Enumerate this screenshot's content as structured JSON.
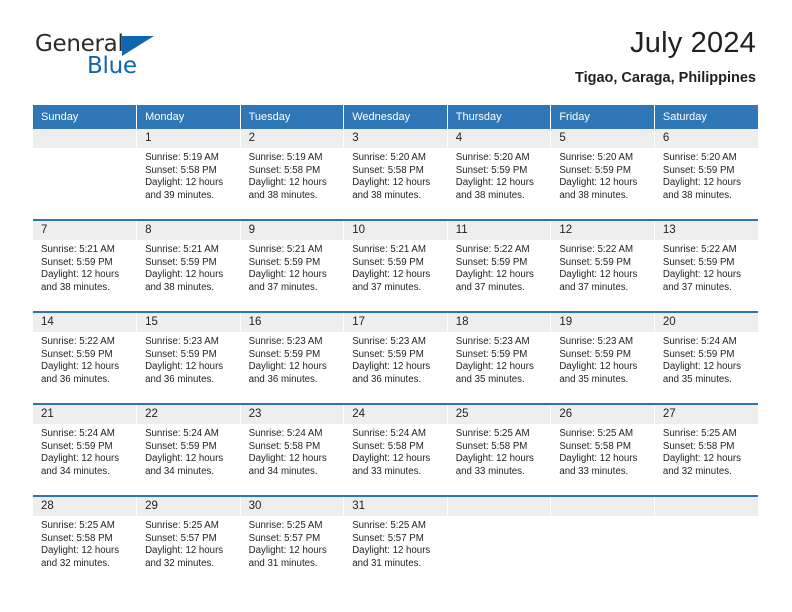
{
  "brand": {
    "name_part1": "General",
    "name_part2": "Blue",
    "logo_icon": "triangle-icon"
  },
  "header": {
    "title": "July 2024",
    "subtitle": "Tigao, Caraga, Philippines"
  },
  "colors": {
    "header_blue": "#3077b8",
    "row_border_blue": "#2e74b5",
    "daynum_bg": "#eeeeee",
    "brand_blue": "#1166b0",
    "text": "#231f20"
  },
  "weekday_headers": [
    "Sunday",
    "Monday",
    "Tuesday",
    "Wednesday",
    "Thursday",
    "Friday",
    "Saturday"
  ],
  "weeks": [
    [
      {
        "day": "",
        "sunrise": "",
        "sunset": "",
        "daylight_1": "",
        "daylight_2": ""
      },
      {
        "day": "1",
        "sunrise": "Sunrise: 5:19 AM",
        "sunset": "Sunset: 5:58 PM",
        "daylight_1": "Daylight: 12 hours",
        "daylight_2": "and 39 minutes."
      },
      {
        "day": "2",
        "sunrise": "Sunrise: 5:19 AM",
        "sunset": "Sunset: 5:58 PM",
        "daylight_1": "Daylight: 12 hours",
        "daylight_2": "and 38 minutes."
      },
      {
        "day": "3",
        "sunrise": "Sunrise: 5:20 AM",
        "sunset": "Sunset: 5:58 PM",
        "daylight_1": "Daylight: 12 hours",
        "daylight_2": "and 38 minutes."
      },
      {
        "day": "4",
        "sunrise": "Sunrise: 5:20 AM",
        "sunset": "Sunset: 5:59 PM",
        "daylight_1": "Daylight: 12 hours",
        "daylight_2": "and 38 minutes."
      },
      {
        "day": "5",
        "sunrise": "Sunrise: 5:20 AM",
        "sunset": "Sunset: 5:59 PM",
        "daylight_1": "Daylight: 12 hours",
        "daylight_2": "and 38 minutes."
      },
      {
        "day": "6",
        "sunrise": "Sunrise: 5:20 AM",
        "sunset": "Sunset: 5:59 PM",
        "daylight_1": "Daylight: 12 hours",
        "daylight_2": "and 38 minutes."
      }
    ],
    [
      {
        "day": "7",
        "sunrise": "Sunrise: 5:21 AM",
        "sunset": "Sunset: 5:59 PM",
        "daylight_1": "Daylight: 12 hours",
        "daylight_2": "and 38 minutes."
      },
      {
        "day": "8",
        "sunrise": "Sunrise: 5:21 AM",
        "sunset": "Sunset: 5:59 PM",
        "daylight_1": "Daylight: 12 hours",
        "daylight_2": "and 38 minutes."
      },
      {
        "day": "9",
        "sunrise": "Sunrise: 5:21 AM",
        "sunset": "Sunset: 5:59 PM",
        "daylight_1": "Daylight: 12 hours",
        "daylight_2": "and 37 minutes."
      },
      {
        "day": "10",
        "sunrise": "Sunrise: 5:21 AM",
        "sunset": "Sunset: 5:59 PM",
        "daylight_1": "Daylight: 12 hours",
        "daylight_2": "and 37 minutes."
      },
      {
        "day": "11",
        "sunrise": "Sunrise: 5:22 AM",
        "sunset": "Sunset: 5:59 PM",
        "daylight_1": "Daylight: 12 hours",
        "daylight_2": "and 37 minutes."
      },
      {
        "day": "12",
        "sunrise": "Sunrise: 5:22 AM",
        "sunset": "Sunset: 5:59 PM",
        "daylight_1": "Daylight: 12 hours",
        "daylight_2": "and 37 minutes."
      },
      {
        "day": "13",
        "sunrise": "Sunrise: 5:22 AM",
        "sunset": "Sunset: 5:59 PM",
        "daylight_1": "Daylight: 12 hours",
        "daylight_2": "and 37 minutes."
      }
    ],
    [
      {
        "day": "14",
        "sunrise": "Sunrise: 5:22 AM",
        "sunset": "Sunset: 5:59 PM",
        "daylight_1": "Daylight: 12 hours",
        "daylight_2": "and 36 minutes."
      },
      {
        "day": "15",
        "sunrise": "Sunrise: 5:23 AM",
        "sunset": "Sunset: 5:59 PM",
        "daylight_1": "Daylight: 12 hours",
        "daylight_2": "and 36 minutes."
      },
      {
        "day": "16",
        "sunrise": "Sunrise: 5:23 AM",
        "sunset": "Sunset: 5:59 PM",
        "daylight_1": "Daylight: 12 hours",
        "daylight_2": "and 36 minutes."
      },
      {
        "day": "17",
        "sunrise": "Sunrise: 5:23 AM",
        "sunset": "Sunset: 5:59 PM",
        "daylight_1": "Daylight: 12 hours",
        "daylight_2": "and 36 minutes."
      },
      {
        "day": "18",
        "sunrise": "Sunrise: 5:23 AM",
        "sunset": "Sunset: 5:59 PM",
        "daylight_1": "Daylight: 12 hours",
        "daylight_2": "and 35 minutes."
      },
      {
        "day": "19",
        "sunrise": "Sunrise: 5:23 AM",
        "sunset": "Sunset: 5:59 PM",
        "daylight_1": "Daylight: 12 hours",
        "daylight_2": "and 35 minutes."
      },
      {
        "day": "20",
        "sunrise": "Sunrise: 5:24 AM",
        "sunset": "Sunset: 5:59 PM",
        "daylight_1": "Daylight: 12 hours",
        "daylight_2": "and 35 minutes."
      }
    ],
    [
      {
        "day": "21",
        "sunrise": "Sunrise: 5:24 AM",
        "sunset": "Sunset: 5:59 PM",
        "daylight_1": "Daylight: 12 hours",
        "daylight_2": "and 34 minutes."
      },
      {
        "day": "22",
        "sunrise": "Sunrise: 5:24 AM",
        "sunset": "Sunset: 5:59 PM",
        "daylight_1": "Daylight: 12 hours",
        "daylight_2": "and 34 minutes."
      },
      {
        "day": "23",
        "sunrise": "Sunrise: 5:24 AM",
        "sunset": "Sunset: 5:58 PM",
        "daylight_1": "Daylight: 12 hours",
        "daylight_2": "and 34 minutes."
      },
      {
        "day": "24",
        "sunrise": "Sunrise: 5:24 AM",
        "sunset": "Sunset: 5:58 PM",
        "daylight_1": "Daylight: 12 hours",
        "daylight_2": "and 33 minutes."
      },
      {
        "day": "25",
        "sunrise": "Sunrise: 5:25 AM",
        "sunset": "Sunset: 5:58 PM",
        "daylight_1": "Daylight: 12 hours",
        "daylight_2": "and 33 minutes."
      },
      {
        "day": "26",
        "sunrise": "Sunrise: 5:25 AM",
        "sunset": "Sunset: 5:58 PM",
        "daylight_1": "Daylight: 12 hours",
        "daylight_2": "and 33 minutes."
      },
      {
        "day": "27",
        "sunrise": "Sunrise: 5:25 AM",
        "sunset": "Sunset: 5:58 PM",
        "daylight_1": "Daylight: 12 hours",
        "daylight_2": "and 32 minutes."
      }
    ],
    [
      {
        "day": "28",
        "sunrise": "Sunrise: 5:25 AM",
        "sunset": "Sunset: 5:58 PM",
        "daylight_1": "Daylight: 12 hours",
        "daylight_2": "and 32 minutes."
      },
      {
        "day": "29",
        "sunrise": "Sunrise: 5:25 AM",
        "sunset": "Sunset: 5:57 PM",
        "daylight_1": "Daylight: 12 hours",
        "daylight_2": "and 32 minutes."
      },
      {
        "day": "30",
        "sunrise": "Sunrise: 5:25 AM",
        "sunset": "Sunset: 5:57 PM",
        "daylight_1": "Daylight: 12 hours",
        "daylight_2": "and 31 minutes."
      },
      {
        "day": "31",
        "sunrise": "Sunrise: 5:25 AM",
        "sunset": "Sunset: 5:57 PM",
        "daylight_1": "Daylight: 12 hours",
        "daylight_2": "and 31 minutes."
      },
      {
        "day": "",
        "sunrise": "",
        "sunset": "",
        "daylight_1": "",
        "daylight_2": ""
      },
      {
        "day": "",
        "sunrise": "",
        "sunset": "",
        "daylight_1": "",
        "daylight_2": ""
      },
      {
        "day": "",
        "sunrise": "",
        "sunset": "",
        "daylight_1": "",
        "daylight_2": ""
      }
    ]
  ]
}
